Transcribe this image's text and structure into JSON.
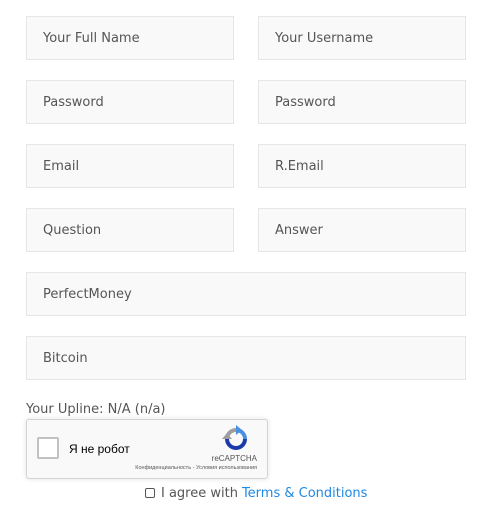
{
  "form": {
    "full_name_placeholder": "Your Full Name",
    "username_placeholder": "Your Username",
    "password_placeholder": "Password",
    "password_confirm_placeholder": "Password",
    "email_placeholder": "Email",
    "email_confirm_placeholder": "R.Email",
    "question_placeholder": "Question",
    "answer_placeholder": "Answer",
    "perfectmoney_placeholder": "PerfectMoney",
    "bitcoin_placeholder": "Bitcoin"
  },
  "upline": {
    "text": "Your Upline: N/A (n/a)"
  },
  "captcha": {
    "label": "Я не робот",
    "brand": "reCAPTCHA",
    "links": "Конфиденциальность - Условия использования",
    "logo_icon": "recaptcha-logo-icon"
  },
  "terms": {
    "prefix": "I agree with",
    "link_text": "Terms & Conditions",
    "link_color": "#1e88e5"
  }
}
